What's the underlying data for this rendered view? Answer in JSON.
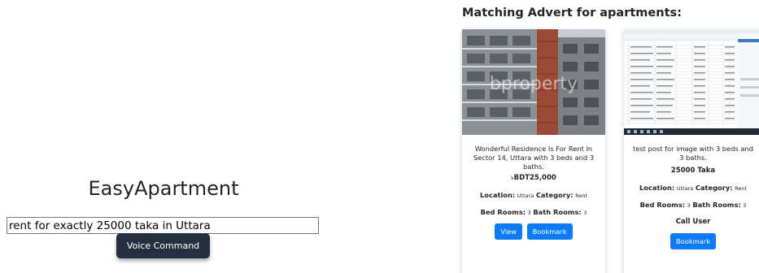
{
  "app": {
    "title": "EasyApartment"
  },
  "search": {
    "query": "rent for exactly 25000 taka in Uttara",
    "voice_label": "Voice Command"
  },
  "results": {
    "heading": "Matching Advert for apartments:",
    "cards": [
      {
        "image_watermark": "bproperty",
        "description": "Wonderful Residence Is For Rent In Sector 14, Uttara with 3 beds and 3 baths.",
        "price": "BDT25,000",
        "price_prefix": "৳",
        "location_label": "Location:",
        "location": "Uttara",
        "category_label": "Category:",
        "category": "Rent",
        "bed_label": "Bed Rooms:",
        "beds": "3",
        "bath_label": "Bath Rooms:",
        "baths": "3",
        "view_label": "View",
        "bookmark_label": "Bookmark"
      },
      {
        "description": "test post for image with 3 beds and 3 baths.",
        "price": "25000 Taka",
        "location_label": "Location:",
        "location": "Uttara",
        "category_label": "Category:",
        "category": "Rent",
        "bed_label": "Bed Rooms:",
        "beds": "3",
        "bath_label": "Bath Rooms:",
        "baths": "3",
        "call_label": "Call User",
        "bookmark_label": "Bookmark"
      }
    ]
  },
  "colors": {
    "primary_button": "#0d7bf7",
    "voice_button": "#24303f"
  }
}
